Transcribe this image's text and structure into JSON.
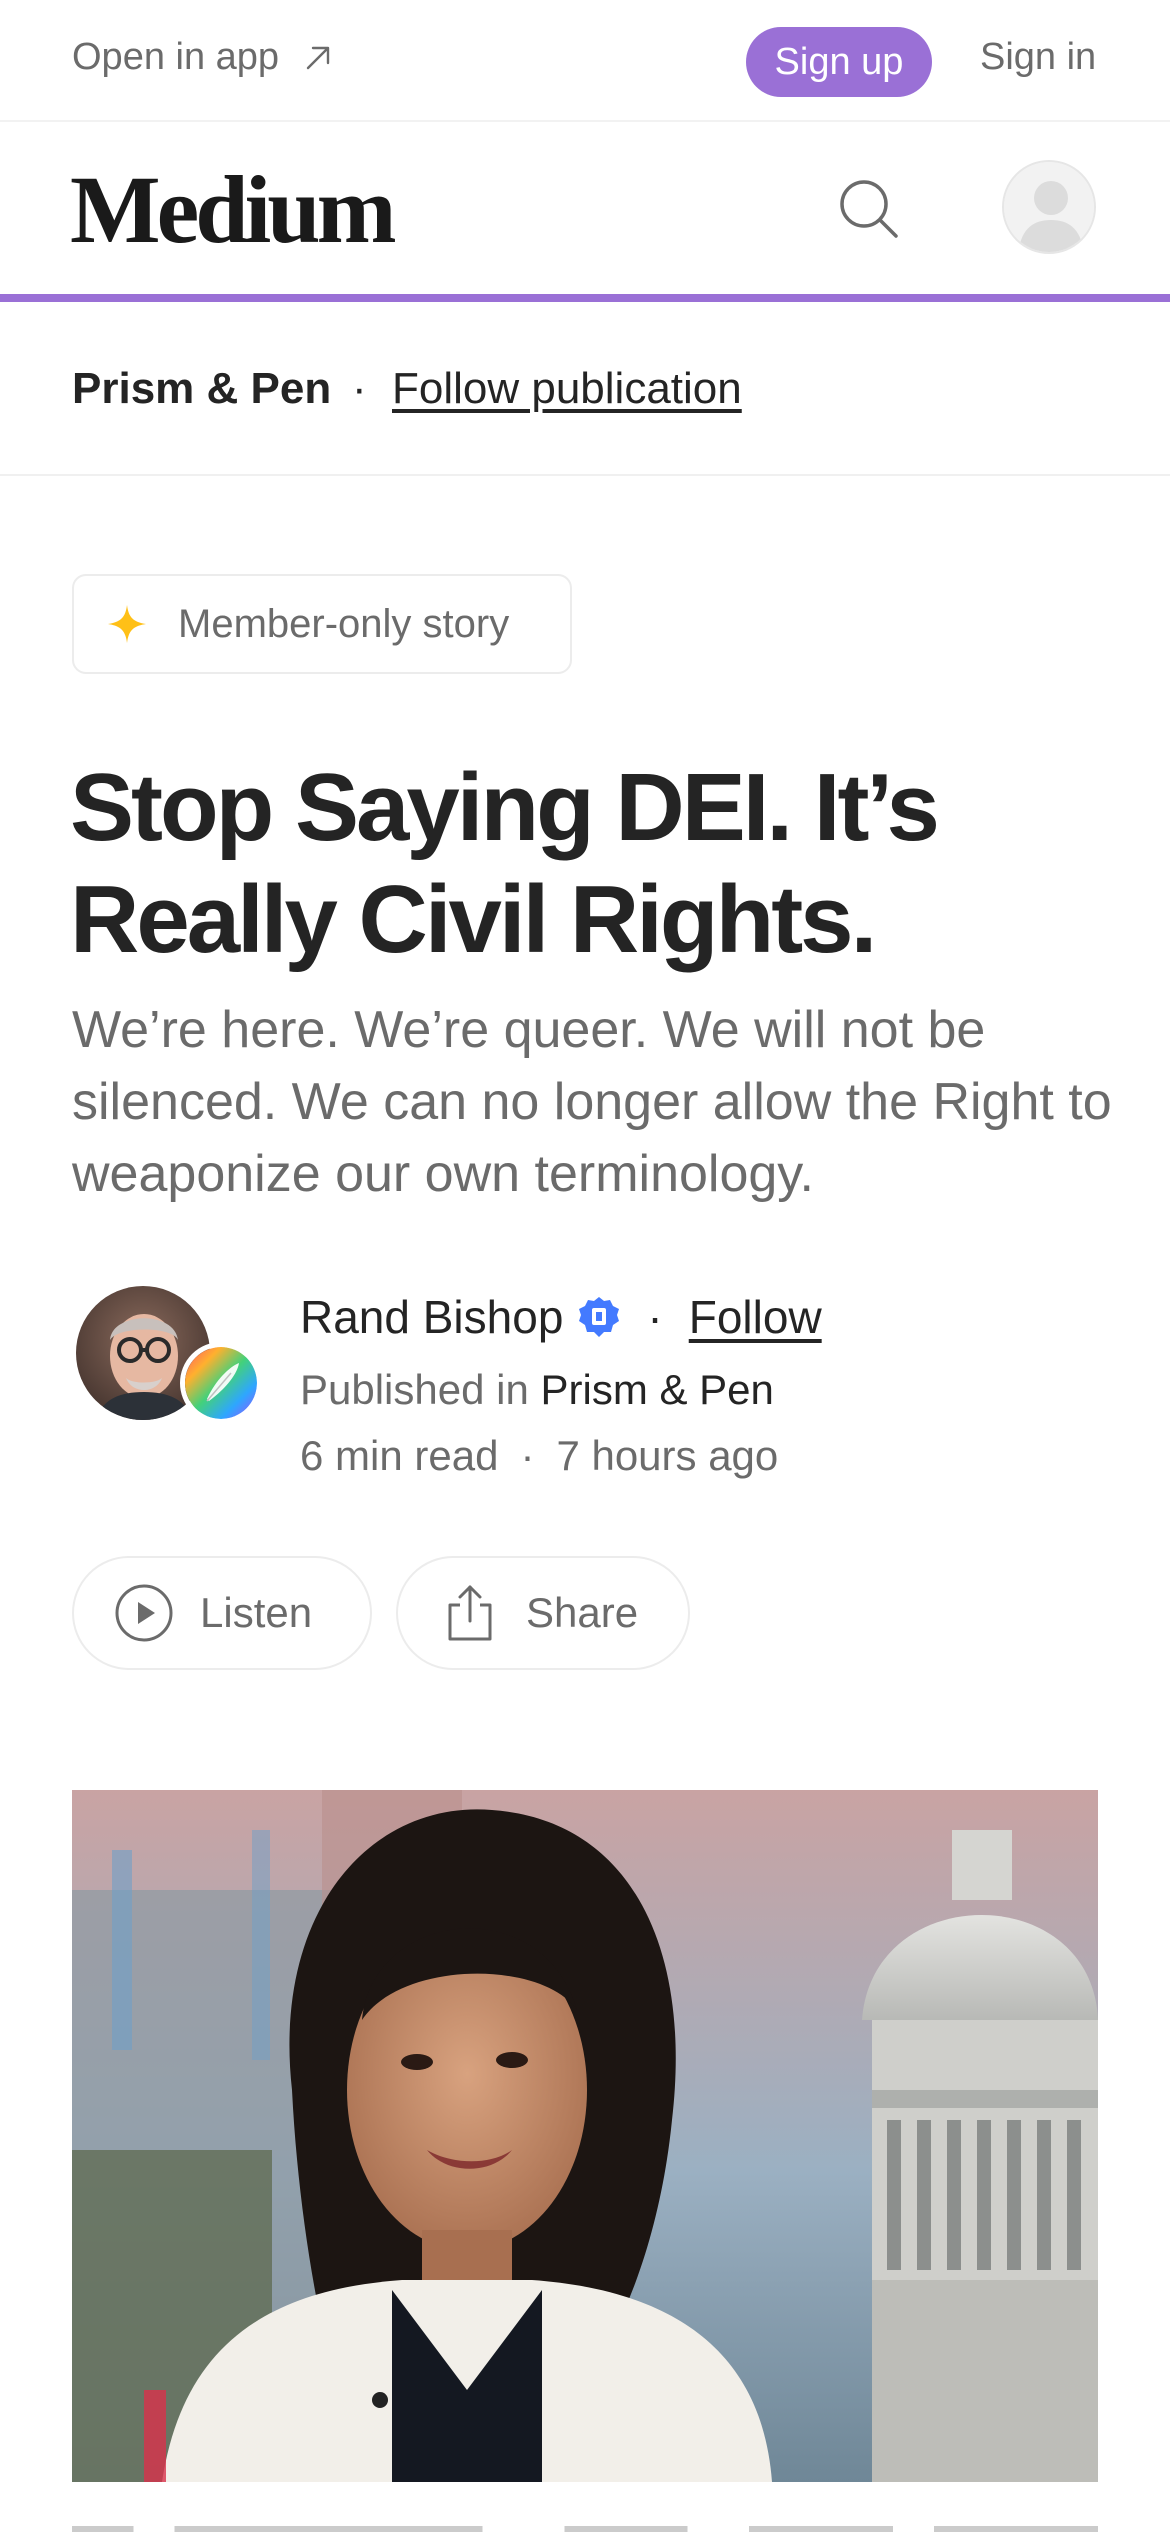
{
  "topbar": {
    "open_in_app": "Open in app",
    "sign_up": "Sign up",
    "sign_in": "Sign in"
  },
  "header": {
    "logo": "Medium",
    "search_icon": "search-icon",
    "avatar_icon": "user-avatar-icon",
    "accent_color": "#9a70d6"
  },
  "publication": {
    "name": "Prism & Pen",
    "separator": "·",
    "follow_label": "Follow publication"
  },
  "badge": {
    "label": "Member-only story",
    "icon": "sparkle-star-icon",
    "icon_color": "#ffc017"
  },
  "article": {
    "title": "Stop Saying DEI. It’s Really Civil Rights.",
    "subtitle": "We’re here. We’re queer. We will not be silenced. We can no longer allow the Right to weaponize our own terminology."
  },
  "author": {
    "name": "Rand Bishop",
    "verified_icon": "verified-badge-icon",
    "separator": "·",
    "follow_label": "Follow",
    "published_in_label": "Published in",
    "published_in_name": "Prism & Pen",
    "read_time": "6 min read",
    "meta_separator": "·",
    "posted": "7 hours ago"
  },
  "actions": {
    "listen_label": "Listen",
    "share_label": "Share"
  },
  "hero": {
    "alt": "hero-photo"
  }
}
